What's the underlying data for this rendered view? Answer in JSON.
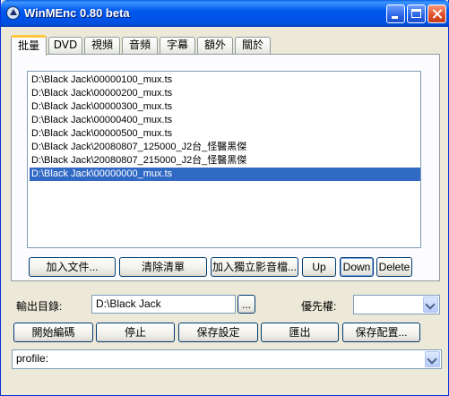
{
  "window": {
    "title": "WinMEnc 0.80 beta"
  },
  "tabs": [
    {
      "label": "批量",
      "active": true
    },
    {
      "label": "DVD"
    },
    {
      "label": "視頻"
    },
    {
      "label": "音頻"
    },
    {
      "label": "字幕"
    },
    {
      "label": "額外"
    },
    {
      "label": "關於"
    }
  ],
  "file_list": {
    "items": [
      "D:\\Black Jack\\00000100_mux.ts",
      "D:\\Black Jack\\00000200_mux.ts",
      "D:\\Black Jack\\00000300_mux.ts",
      "D:\\Black Jack\\00000400_mux.ts",
      "D:\\Black Jack\\00000500_mux.ts",
      "D:\\Black Jack\\20080807_125000_J2台_怪醫黑傑",
      "D:\\Black Jack\\20080807_215000_J2台_怪醫黑傑",
      "D:\\Black Jack\\00000000_mux.ts"
    ],
    "selected_index": 7
  },
  "list_buttons": {
    "add_files": "加入文件...",
    "clear_list": "清除清單",
    "add_separate_audio": "加入獨立影音檔...",
    "up": "Up",
    "down": "Down",
    "delete": "Delete"
  },
  "output": {
    "label": "輸出目錄:",
    "value": "D:\\Black Jack",
    "browse": "..."
  },
  "priority": {
    "label": "優先權:",
    "value": ""
  },
  "actions": {
    "start": "開始編碼",
    "stop": "停止",
    "save_settings": "保存設定",
    "export": "匯出",
    "save_config": "保存配置..."
  },
  "profile": {
    "value": "profile:"
  },
  "colors": {
    "titlebar": "#0058ee",
    "selection": "#316ac5",
    "tab_highlight": "#ffc83c",
    "window_bg": "#ece9d8"
  }
}
